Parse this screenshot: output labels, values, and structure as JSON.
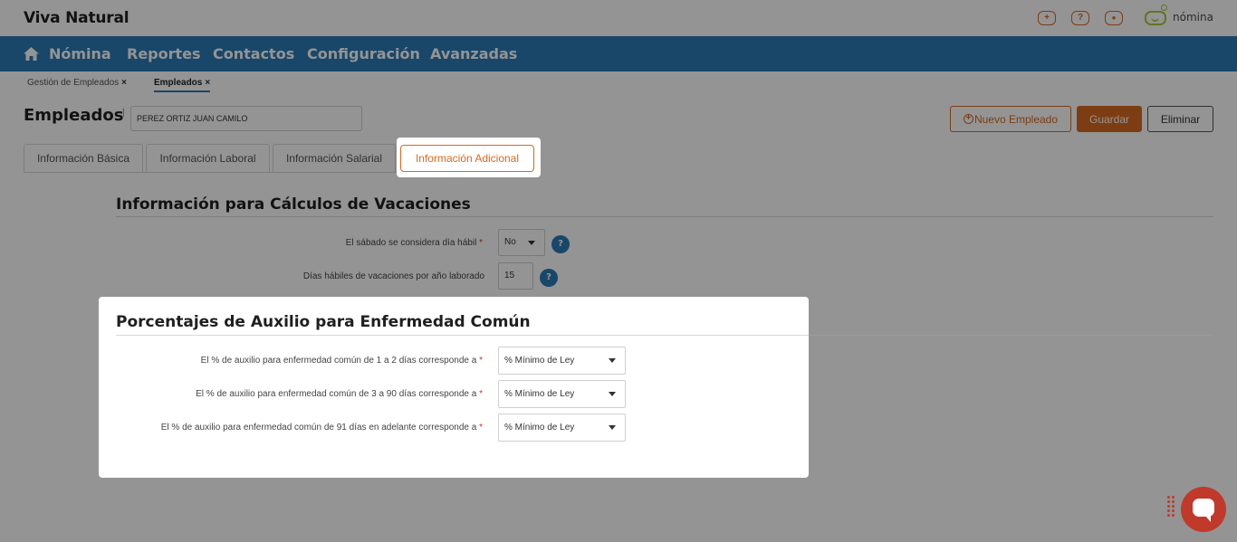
{
  "app": {
    "company": "Viva Natural",
    "brand_label": "nómina"
  },
  "top_icons": {
    "plus": "+",
    "help": "?",
    "user": "●"
  },
  "nav": {
    "items": [
      {
        "label": "Nómina"
      },
      {
        "label": "Reportes"
      },
      {
        "label": "Contactos"
      },
      {
        "label": "Configuración"
      },
      {
        "label": "Avanzadas"
      }
    ]
  },
  "breadcrumbs": [
    {
      "label": "Gestión de Empleados",
      "close": "×"
    },
    {
      "label": "Empleados",
      "close": "×"
    }
  ],
  "header": {
    "title": "Empleados",
    "separator": "|",
    "employee_value": "PEREZ ORTIZ JUAN CAMILO",
    "new_button": "Nuevo Empleado",
    "new_icon": "+",
    "save_button": "Guardar",
    "delete_button": "Eliminar"
  },
  "tabs": [
    {
      "label": "Información Básica"
    },
    {
      "label": "Información Laboral"
    },
    {
      "label": "Información Salarial"
    },
    {
      "label": "Información Adicional",
      "active": true
    }
  ],
  "vacaciones": {
    "title": "Información para Cálculos de Vacaciones",
    "sabado_label": "El sábado se considera día hábil",
    "sabado_value": "No",
    "dias_label": "Días hábiles de vacaciones por año laborado",
    "dias_value": "15",
    "required_mark": "*",
    "help_mark": "?"
  },
  "auxilio": {
    "title": "Porcentajes de Auxilio para Enfermedad Común",
    "fields": [
      {
        "label": "El % de auxilio para enfermedad común de 1 a 2 días corresponde a",
        "value": "% Mínimo de Ley"
      },
      {
        "label": "El % de auxilio para enfermedad común de 3 a 90 días corresponde a",
        "value": "% Mínimo de Ley"
      },
      {
        "label": "El % de auxilio para enfermedad común de 91 días en adelante corresponde a",
        "value": "% Mínimo de Ley"
      }
    ]
  },
  "colors": {
    "nav_bg": "#2a7ab5",
    "accent": "#d8691f",
    "chat": "#c0392b",
    "brand_green": "#a8c93a"
  }
}
